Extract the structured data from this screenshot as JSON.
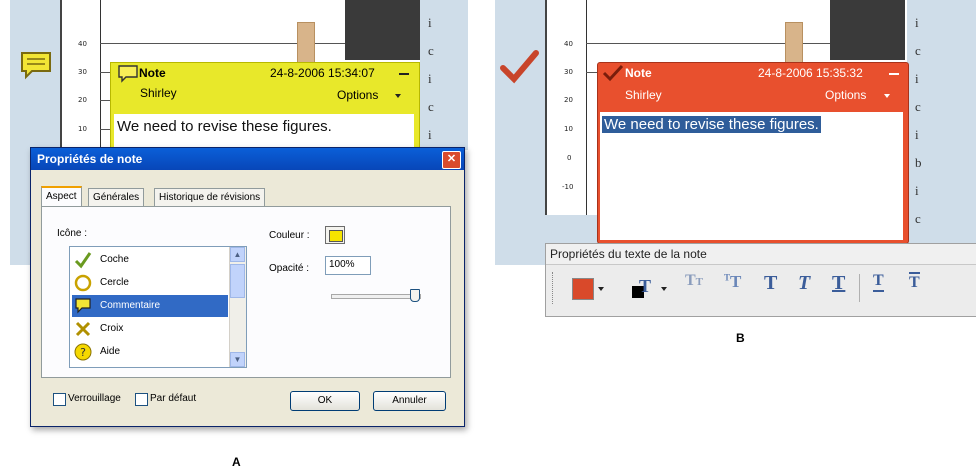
{
  "captions": {
    "a": "A",
    "b": "B"
  },
  "left_panel": {
    "ruler_ticks": [
      "40",
      "30",
      "20",
      "10"
    ],
    "note": {
      "title": "Note",
      "timestamp": "24-8-2006 15:34:07",
      "author": "Shirley",
      "options": "Options",
      "body": "We need to revise these figures.",
      "color": "#e8e82a"
    },
    "margin_letters": [
      "i",
      "c",
      "i",
      "c",
      "i"
    ]
  },
  "dialog": {
    "title": "Propriétés de note",
    "tabs": [
      "Aspect",
      "Générales",
      "Historique de révisions"
    ],
    "icon_label": "Icône :",
    "icons": [
      {
        "label": "Coche",
        "icon": "check-icon"
      },
      {
        "label": "Cercle",
        "icon": "circle-icon"
      },
      {
        "label": "Commentaire",
        "icon": "comment-icon"
      },
      {
        "label": "Croix",
        "icon": "cross-icon"
      },
      {
        "label": "Aide",
        "icon": "help-icon"
      }
    ],
    "selected_icon": "Commentaire",
    "color_label": "Couleur :",
    "color_value": "#f5e400",
    "opacity_label": "Opacité :",
    "opacity_value": "100%",
    "opacity_level": 1.0,
    "lock_label": "Verrouillage",
    "default_label": "Par défaut",
    "ok": "OK",
    "cancel": "Annuler"
  },
  "right_panel": {
    "ruler_ticks": [
      "40",
      "30",
      "20",
      "10",
      "0",
      "-10"
    ],
    "note": {
      "title": "Note",
      "timestamp": "24-8-2006 15:35:32",
      "author": "Shirley",
      "options": "Options",
      "body": "We need to revise these figures.",
      "color": "#e8502e"
    },
    "margin_letters": [
      "i",
      "c",
      "i",
      "c",
      "i",
      "b",
      "i",
      "c"
    ]
  },
  "toolbar": {
    "title": "Propriétés du texte de la note",
    "fill_color": "#d9492a",
    "text_color": "#000000",
    "icons": [
      "fill-color-icon",
      "text-color-icon",
      "small-caps-icon",
      "superscript-icon",
      "bold-icon",
      "italic-icon",
      "underline-icon",
      "line-spacing-icon",
      "text-align-icon"
    ]
  }
}
